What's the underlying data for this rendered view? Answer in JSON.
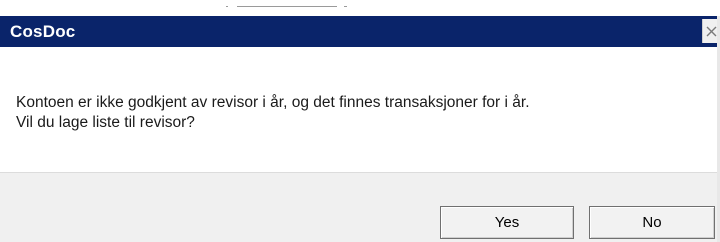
{
  "dialog": {
    "title": "CosDoc",
    "message_line1": "Kontoen er ikke godkjent av revisor i år, og det finnes transaksjoner for i år.",
    "message_line2": "Vil du lage liste til revisor?",
    "buttons": {
      "yes_label": "Yes",
      "no_label": "No"
    },
    "close_icon": "close-icon"
  },
  "colors": {
    "titlebar": "#0a246a",
    "title_text": "#ffffff",
    "footer": "#f0f0f0"
  }
}
